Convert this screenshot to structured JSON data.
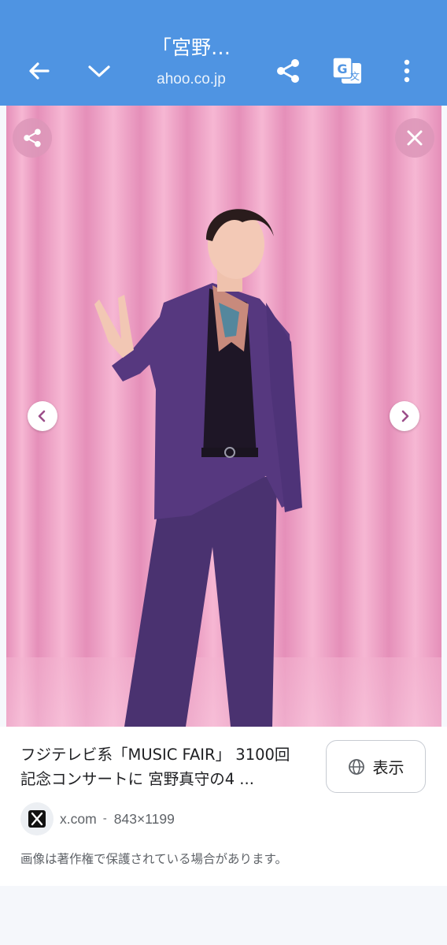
{
  "toolbar": {
    "title": "「宮野…",
    "url": "ahoo.co.jp",
    "icons": [
      "back-arrow-icon",
      "chevron-down-icon",
      "share-icon",
      "translate-icon",
      "more-vert-icon"
    ],
    "color": "#4f94e2"
  },
  "viewer": {
    "buttons": [
      "share-icon",
      "close-icon",
      "chevron-left-icon",
      "chevron-right-icon"
    ],
    "background_color": "#f2a6c9"
  },
  "result": {
    "caption_line1": "フジテレビ系「MUSIC FAIR」 3100回",
    "caption_line2": "記念コンサートに 宮野真守の4 ...",
    "view_button_label": "表示",
    "source_domain": "x.com",
    "separator": "-",
    "dimensions": "843×1199",
    "copyright_notice": "画像は著作権で保護されている場合があります。"
  }
}
